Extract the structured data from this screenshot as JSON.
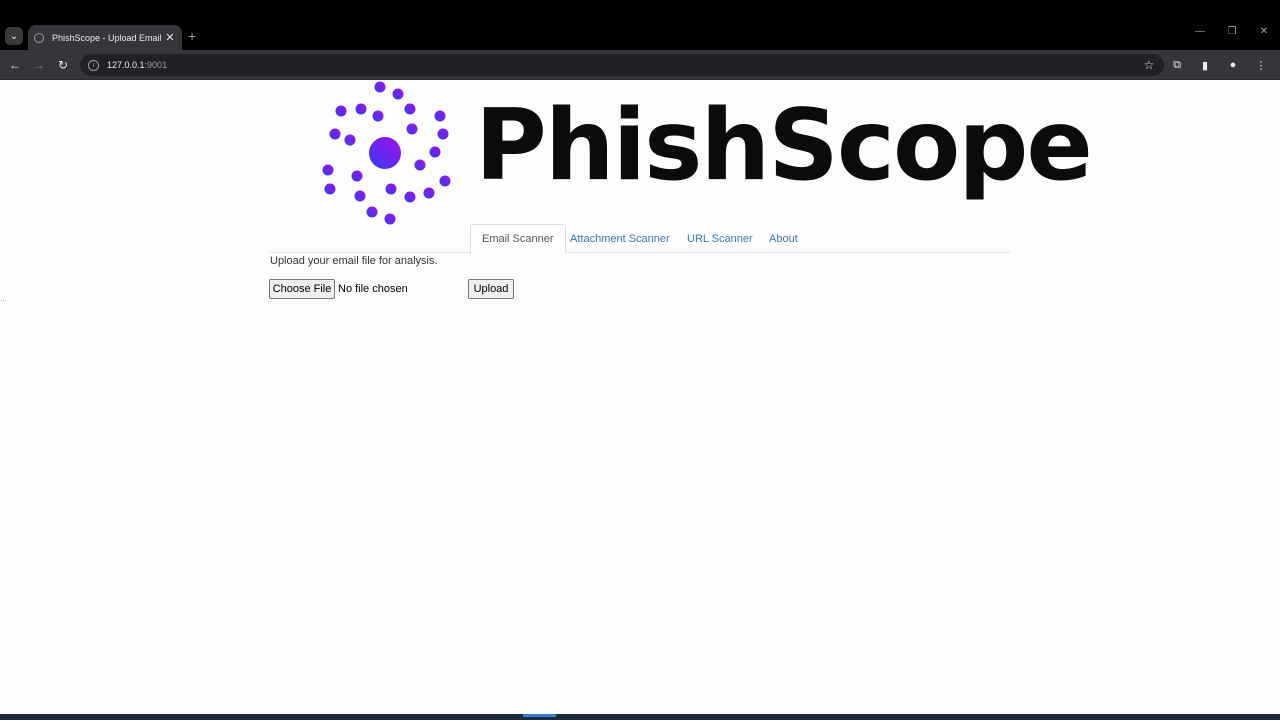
{
  "browser": {
    "tab_title": "PhishScope - Upload Email",
    "url_host": "127.0.0.1",
    "url_port": ":9001"
  },
  "logo": {
    "text": "PhishScope",
    "gradient_start": "#2f3df0",
    "gradient_end": "#a80ef0"
  },
  "nav": {
    "tabs": [
      {
        "label": "Email Scanner",
        "active": true
      },
      {
        "label": "Attachment Scanner",
        "active": false
      },
      {
        "label": "URL Scanner",
        "active": false
      },
      {
        "label": "About",
        "active": false
      }
    ]
  },
  "form": {
    "intro": "Upload your email file for analysis.",
    "choose_label": "Choose File",
    "file_status": "No file chosen",
    "upload_label": "Upload"
  },
  "misc": {
    "ellipsis": "..."
  }
}
